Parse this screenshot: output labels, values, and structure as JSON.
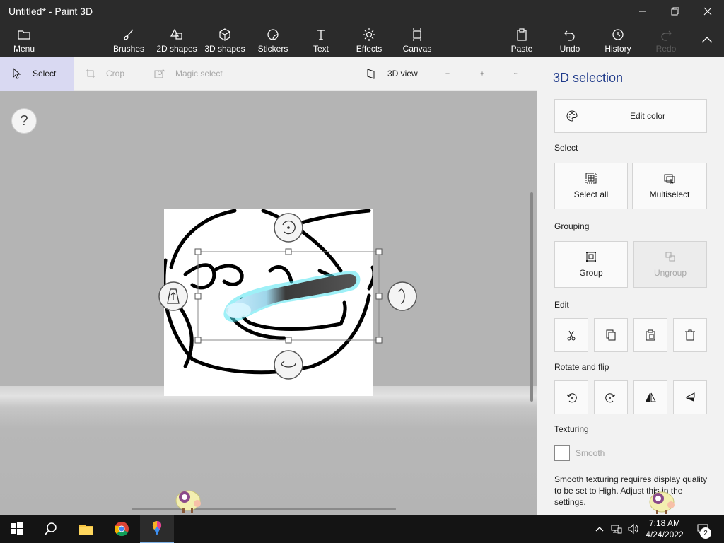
{
  "window": {
    "title": "Untitled* - Paint 3D"
  },
  "toolbar": {
    "menu": "Menu",
    "brushes": "Brushes",
    "shapes2d": "2D shapes",
    "shapes3d": "3D shapes",
    "stickers": "Stickers",
    "text": "Text",
    "effects": "Effects",
    "canvas": "Canvas",
    "paste": "Paste",
    "undo": "Undo",
    "history": "History",
    "redo": "Redo"
  },
  "subbar": {
    "select": "Select",
    "crop": "Crop",
    "magic_select": "Magic select",
    "view3d": "3D view"
  },
  "canvas": {
    "help": "?"
  },
  "panel": {
    "title": "3D selection",
    "edit_color": "Edit color",
    "select_section": "Select",
    "select_all": "Select all",
    "multiselect": "Multiselect",
    "grouping_section": "Grouping",
    "group": "Group",
    "ungroup": "Ungroup",
    "edit_section": "Edit",
    "rotate_section": "Rotate and flip",
    "texturing_section": "Texturing",
    "smooth": "Smooth",
    "note": "Smooth texturing requires display quality to be set to High. Adjust this in the settings."
  },
  "taskbar": {
    "time": "7:18 AM",
    "date": "4/24/2022",
    "notifications": "2"
  },
  "colors": {
    "accent": "#1f3a8a",
    "select_glow": "#4fe3f0",
    "workspace": "#b4b4b4"
  }
}
